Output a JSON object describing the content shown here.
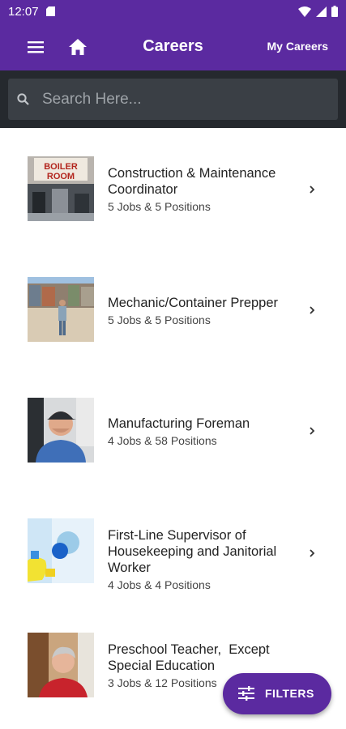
{
  "status_bar": {
    "time": "12:07"
  },
  "app_bar": {
    "title": "Careers",
    "my_careers_label": "My Careers"
  },
  "search": {
    "placeholder": "Search Here..."
  },
  "careers": [
    {
      "title": "Construction & Maintenance Coordinator",
      "summary": "5 Jobs & 5 Positions",
      "image": "boiler-room-photo",
      "thumb_text": "BOILER ROOM"
    },
    {
      "title": "Mechanic/Container Prepper",
      "summary": "5 Jobs & 5 Positions",
      "image": "worker-at-container-yard-photo"
    },
    {
      "title": "Manufacturing Foreman",
      "summary": "4 Jobs & 58 Positions",
      "image": "man-in-cap-photo"
    },
    {
      "title": "First-Line Supervisor of Housekeeping and Janitorial Worker",
      "summary": "4 Jobs & 4 Positions",
      "image": "cleaning-gloves-photo"
    },
    {
      "title": "Preschool Teacher,  Except Special Education",
      "summary": "3 Jobs & 12 Positions",
      "image": "teacher-portrait-photo"
    }
  ],
  "fab": {
    "label": "FILTERS"
  },
  "colors": {
    "primary": "#5b2aa0",
    "search_bg": "#25292e",
    "search_field": "#3a3f45"
  }
}
